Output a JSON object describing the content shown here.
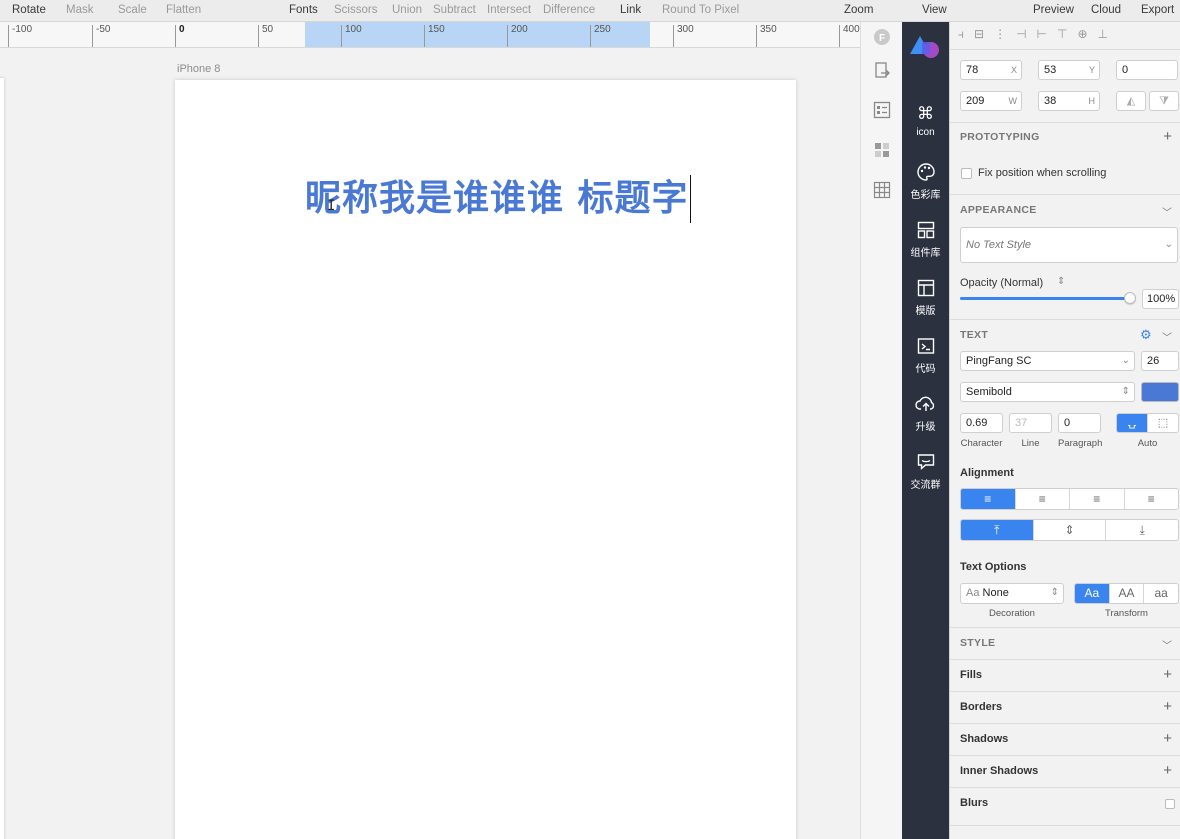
{
  "toolbar": {
    "items": [
      "Rotate",
      "Mask",
      "Scale",
      "Flatten",
      "Fonts",
      "Scissors",
      "Union",
      "Subtract",
      "Intersect",
      "Difference",
      "Link",
      "Round To Pixel",
      "Zoom",
      "View",
      "Preview",
      "Cloud",
      "Export"
    ]
  },
  "ruler": {
    "ticks": [
      "-100",
      "-50",
      "0",
      "50",
      "100",
      "150",
      "200",
      "250",
      "300",
      "350",
      "400"
    ]
  },
  "canvas": {
    "artboard_name": "iPhone 8",
    "text_content": "昵称我是谁谁谁 标题字",
    "text_color": "#4a78d5"
  },
  "sidebar": {
    "items": [
      {
        "label": "icon",
        "icon": "grid-cmd-icon"
      },
      {
        "label": "色彩库",
        "icon": "palette-icon"
      },
      {
        "label": "组件库",
        "icon": "components-icon"
      },
      {
        "label": "模版",
        "icon": "template-icon"
      },
      {
        "label": "代码",
        "icon": "code-icon"
      },
      {
        "label": "升级",
        "icon": "cloud-upload-icon"
      },
      {
        "label": "交流群",
        "icon": "chat-icon"
      }
    ]
  },
  "inspector": {
    "x": "78",
    "x_label": "X",
    "y": "53",
    "y_label": "Y",
    "rotation": "0",
    "w": "209",
    "w_label": "W",
    "h": "38",
    "h_label": "H",
    "prototyping": {
      "title": "PROTOTYPING",
      "fix_label": "Fix position when scrolling"
    },
    "appearance": {
      "title": "APPEARANCE",
      "text_style": "No Text Style",
      "opacity_label": "Opacity (Normal)",
      "opacity_value": "100%",
      "opacity": 1.0
    },
    "text": {
      "title": "TEXT",
      "font": "PingFang SC",
      "size": "26",
      "weight": "Semibold",
      "color": "#4a78d5",
      "character": "0.69",
      "line": "37",
      "paragraph": "0",
      "character_label": "Character",
      "line_label": "Line",
      "paragraph_label": "Paragraph",
      "auto_label": "Auto",
      "alignment_title": "Alignment",
      "text_options_title": "Text Options",
      "decoration_value": "None",
      "decoration_label": "Decoration",
      "transform_label": "Transform",
      "transform_options": [
        "Aa",
        "AA",
        "aa"
      ]
    },
    "style": {
      "title": "STYLE",
      "rows": [
        "Fills",
        "Borders",
        "Shadows",
        "Inner Shadows",
        "Blurs"
      ]
    }
  }
}
